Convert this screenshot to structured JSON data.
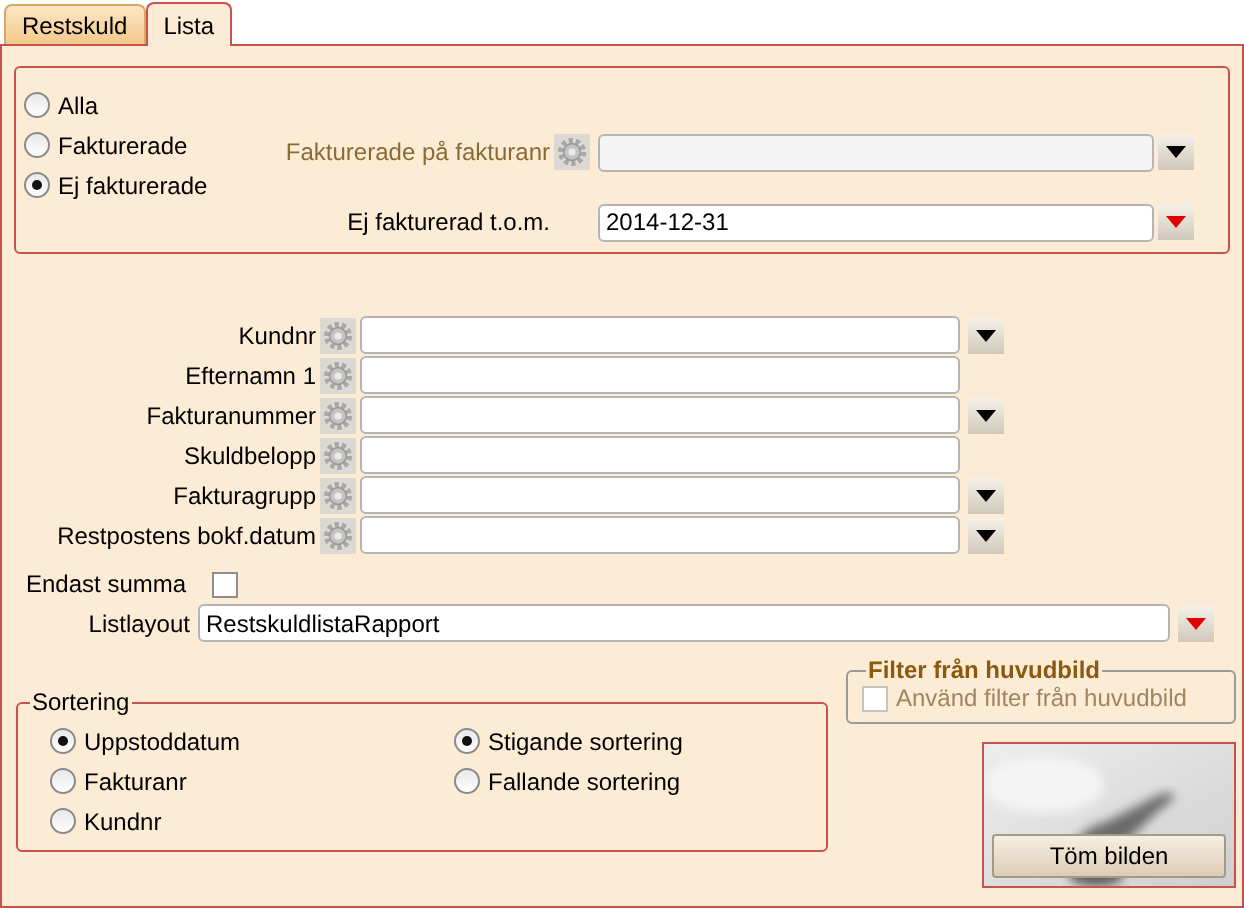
{
  "tabs": [
    {
      "label": "Restskuld",
      "selected": false
    },
    {
      "label": "Lista",
      "selected": true
    }
  ],
  "invoice_filter": {
    "options": [
      {
        "label": "Alla",
        "selected": false
      },
      {
        "label": "Fakturerade",
        "selected": false
      },
      {
        "label": "Ej fakturerade",
        "selected": true
      }
    ],
    "fields": [
      {
        "label": "Fakturerade på fakturanr",
        "disabled": true,
        "gear": true,
        "color": "#000000"
      },
      {
        "label": "Ej fakturerad t.o.m.",
        "disabled": false,
        "gear": false,
        "value": "2014-12-31",
        "color": "#e00000"
      }
    ]
  },
  "criteria": [
    {
      "label": "Kundnr",
      "dropdown": true
    },
    {
      "label": "Efternamn 1",
      "dropdown": false
    },
    {
      "label": "Fakturanummer",
      "dropdown": true
    },
    {
      "label": "Skuldbelopp",
      "dropdown": false
    },
    {
      "label": "Fakturagrupp",
      "dropdown": true
    },
    {
      "label": "Restpostens bokf.datum",
      "dropdown": true
    }
  ],
  "only_sum": {
    "label": "Endast summa",
    "checked": false
  },
  "list_layout": {
    "label": "Listlayout",
    "value": "RestskuldlistaRapport",
    "color": "#e00000"
  },
  "sorting": {
    "title": "Sortering",
    "sort_by": [
      {
        "label": "Uppstoddatum",
        "selected": true
      },
      {
        "label": "Fakturanr",
        "selected": false
      },
      {
        "label": "Kundnr",
        "selected": false
      }
    ],
    "order": [
      {
        "label": "Stigande sortering",
        "selected": true
      },
      {
        "label": "Fallande sortering",
        "selected": false
      }
    ]
  },
  "main_filter": {
    "title": "Filter från huvudbild",
    "checkbox": {
      "label": "Använd filter från huvudbild",
      "checked": false,
      "disabled": true
    }
  },
  "image": {
    "kind": "picture",
    "button": "Töm bilden"
  }
}
